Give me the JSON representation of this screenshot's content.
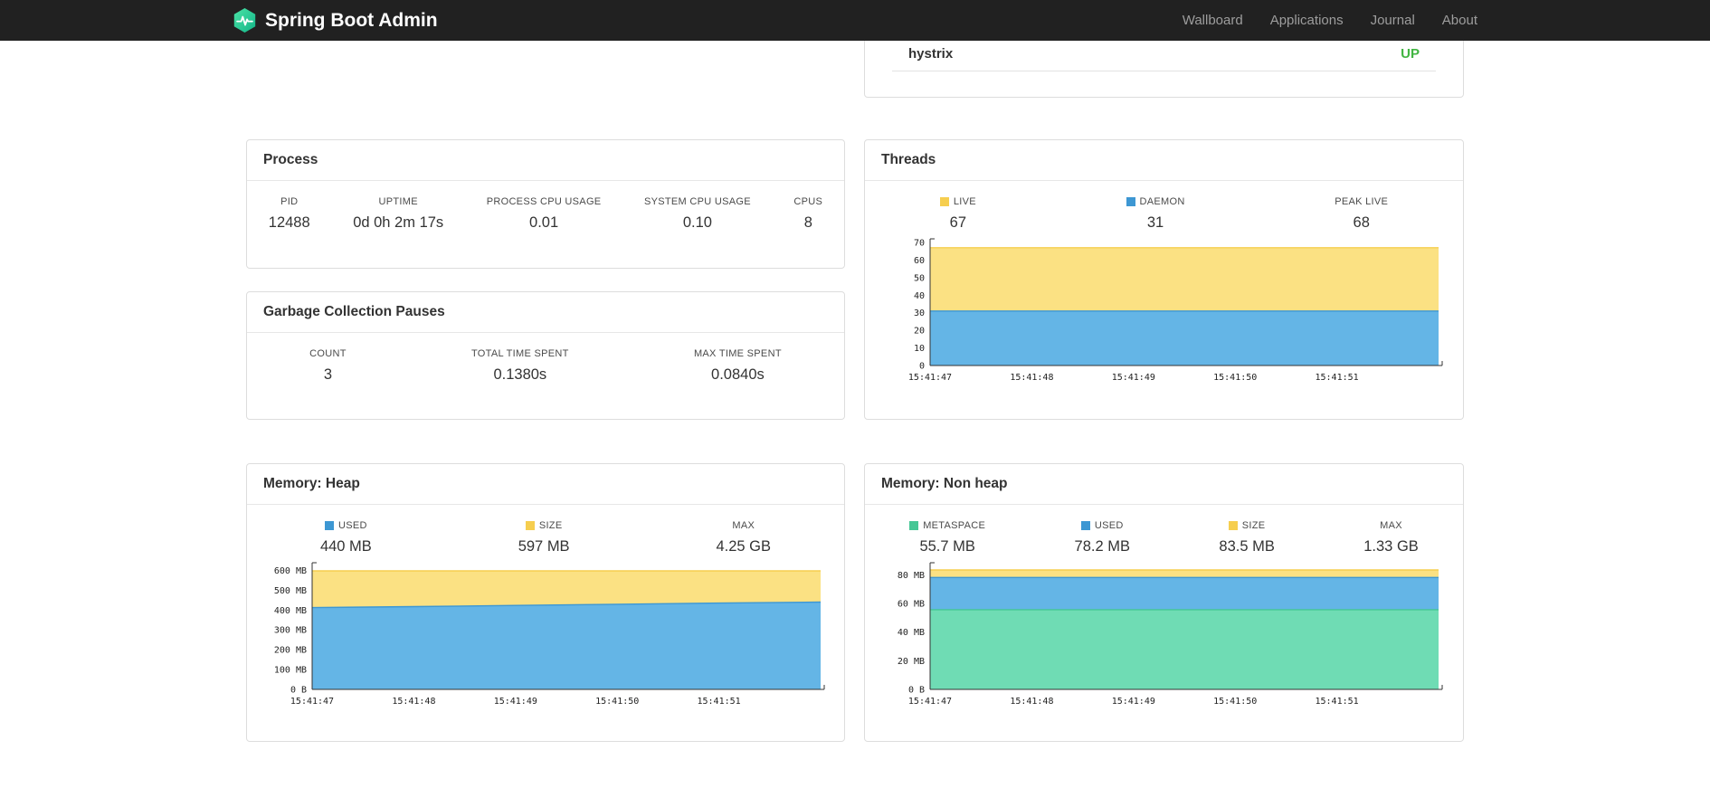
{
  "navbar": {
    "brand": "Spring Boot Admin",
    "links": [
      "Wallboard",
      "Applications",
      "Journal",
      "About"
    ]
  },
  "application_status": {
    "name": "hystrix",
    "status": "UP",
    "status_color": "#42b542"
  },
  "colors": {
    "yellow": {
      "area": "#FBE183",
      "line": "#F6CE4F",
      "swatch": "#F6CE4F"
    },
    "blue": {
      "area": "#64B5E6",
      "line": "#3D97D3",
      "swatch": "#3D97D3"
    },
    "green": {
      "area": "#6FDCB4",
      "line": "#45C795",
      "swatch": "#45C795"
    }
  },
  "panels": {
    "process": {
      "title": "Process",
      "stats": [
        {
          "label": "PID",
          "value": "12488",
          "swatch": null
        },
        {
          "label": "UPTIME",
          "value": "0d 0h 2m 17s",
          "swatch": null
        },
        {
          "label": "PROCESS CPU USAGE",
          "value": "0.01",
          "swatch": null
        },
        {
          "label": "SYSTEM CPU USAGE",
          "value": "0.10",
          "swatch": null
        },
        {
          "label": "CPUS",
          "value": "8",
          "swatch": null
        }
      ]
    },
    "gc": {
      "title": "Garbage Collection Pauses",
      "stats": [
        {
          "label": "COUNT",
          "value": "3",
          "swatch": null
        },
        {
          "label": "TOTAL TIME SPENT",
          "value": "0.1380s",
          "swatch": null
        },
        {
          "label": "MAX TIME SPENT",
          "value": "0.0840s",
          "swatch": null
        }
      ]
    },
    "threads": {
      "title": "Threads",
      "stats": [
        {
          "label": "LIVE",
          "value": "67",
          "swatch": "yellow"
        },
        {
          "label": "DAEMON",
          "value": "31",
          "swatch": "blue"
        },
        {
          "label": "PEAK LIVE",
          "value": "68",
          "swatch": null
        }
      ],
      "chart": {
        "type": "area",
        "y_scale_max": 70,
        "y_ticks": [
          {
            "v": 70,
            "label": "70"
          },
          {
            "v": 60,
            "label": "60"
          },
          {
            "v": 50,
            "label": "50"
          },
          {
            "v": 40,
            "label": "40"
          },
          {
            "v": 30,
            "label": "30"
          },
          {
            "v": 20,
            "label": "20"
          },
          {
            "v": 10,
            "label": "10"
          },
          {
            "v": 0,
            "label": "0"
          }
        ],
        "x_labels": [
          "15:41:47",
          "15:41:48",
          "15:41:49",
          "15:41:50",
          "15:41:51"
        ],
        "series": [
          {
            "name": "live",
            "color": "yellow",
            "values": [
              67,
              67,
              67,
              67,
              67,
              67
            ]
          },
          {
            "name": "daemon",
            "color": "blue",
            "values": [
              31,
              31,
              31,
              31,
              31,
              31
            ]
          }
        ]
      }
    },
    "memory_heap": {
      "title": "Memory: Heap",
      "stats": [
        {
          "label": "USED",
          "value": "440 MB",
          "swatch": "blue"
        },
        {
          "label": "SIZE",
          "value": "597 MB",
          "swatch": "yellow"
        },
        {
          "label": "MAX",
          "value": "4.25 GB",
          "swatch": null
        }
      ],
      "chart": {
        "type": "area",
        "y_scale_max": 620,
        "y_ticks": [
          {
            "v": 600,
            "label": "600 MB"
          },
          {
            "v": 500,
            "label": "500 MB"
          },
          {
            "v": 400,
            "label": "400 MB"
          },
          {
            "v": 300,
            "label": "300 MB"
          },
          {
            "v": 200,
            "label": "200 MB"
          },
          {
            "v": 100,
            "label": "100 MB"
          },
          {
            "v": 0,
            "label": "0 B"
          }
        ],
        "x_labels": [
          "15:41:47",
          "15:41:48",
          "15:41:49",
          "15:41:50",
          "15:41:51"
        ],
        "series": [
          {
            "name": "size",
            "color": "yellow",
            "values": [
              597,
              597,
              597,
              597,
              597,
              597
            ]
          },
          {
            "name": "used",
            "color": "blue",
            "values": [
              412,
              417,
              423,
              429,
              435,
              440
            ]
          }
        ]
      }
    },
    "memory_non_heap": {
      "title": "Memory: Non heap",
      "stats": [
        {
          "label": "METASPACE",
          "value": "55.7 MB",
          "swatch": "green"
        },
        {
          "label": "USED",
          "value": "78.2 MB",
          "swatch": "blue"
        },
        {
          "label": "SIZE",
          "value": "83.5 MB",
          "swatch": "yellow"
        },
        {
          "label": "MAX",
          "value": "1.33 GB",
          "swatch": null
        }
      ],
      "chart": {
        "type": "area",
        "y_scale_max": 86,
        "y_ticks": [
          {
            "v": 80,
            "label": "80 MB"
          },
          {
            "v": 60,
            "label": "60 MB"
          },
          {
            "v": 40,
            "label": "40 MB"
          },
          {
            "v": 20,
            "label": "20 MB"
          },
          {
            "v": 0,
            "label": "0 B"
          }
        ],
        "x_labels": [
          "15:41:47",
          "15:41:48",
          "15:41:49",
          "15:41:50",
          "15:41:51"
        ],
        "series": [
          {
            "name": "size",
            "color": "yellow",
            "values": [
              83.5,
              83.5,
              83.5,
              83.5,
              83.5,
              83.5
            ]
          },
          {
            "name": "used",
            "color": "blue",
            "values": [
              78.2,
              78.2,
              78.2,
              78.2,
              78.2,
              78.2
            ]
          },
          {
            "name": "metaspace",
            "color": "green",
            "values": [
              55.7,
              55.7,
              55.7,
              55.7,
              55.7,
              55.7
            ]
          }
        ]
      }
    }
  }
}
